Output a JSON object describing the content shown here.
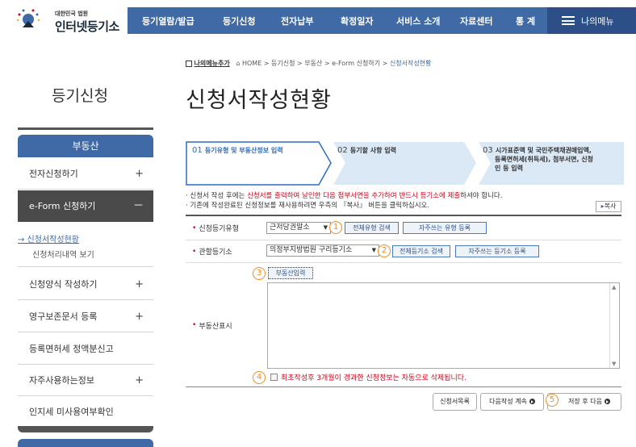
{
  "header": {
    "logo_sub": "대한민국 법원",
    "logo_main": "인터넷등기소",
    "gnb": [
      "등기열람/발급",
      "등기신청",
      "전자납부",
      "확정일자",
      "서비스 소개",
      "자료센터",
      "통 계"
    ],
    "my_menu": "나의메뉴"
  },
  "sidebar": {
    "title": "등기신청",
    "section": "부동산",
    "items": [
      {
        "label": "전자신청하기",
        "toggle": "+"
      },
      {
        "label": "e-Form 신청하기",
        "toggle": "－"
      },
      {
        "label": "신청양식 작성하기",
        "toggle": "+"
      },
      {
        "label": "영구보존문서 등록",
        "toggle": "+"
      },
      {
        "label": "등록면허세 정액분신고",
        "toggle": ""
      },
      {
        "label": "자주사용하는정보",
        "toggle": "+"
      },
      {
        "label": "인지세 미사용여부확인",
        "toggle": ""
      }
    ],
    "sub_items": [
      "→ 신청서작성현황",
      "신청처리내역 보기"
    ]
  },
  "breadcrumb": {
    "favorite": "나의메뉴추가",
    "path": "HOME > 등기신청 > 부동산 > e-Form 신청하기 > ",
    "current": "신청서작성현황"
  },
  "page_title": "신청서작성현황",
  "steps": [
    {
      "num": "01",
      "text": "등기유형 및 부동산정보 입력"
    },
    {
      "num": "02",
      "text": "등기할 사항 입력"
    },
    {
      "num": "03",
      "text_lines": [
        "시가표준액 및 국민주택채권매입액,",
        "등록면허세(취득세), 첨부서면, 신청",
        "인 등 입력"
      ]
    }
  ],
  "notes": {
    "line1_a": "· 신청서 작성 후에는 ",
    "line1_red": "신청서를 출력하여 날인한 다음 첨부서면을 추가하여 반드시 등기소에 제출",
    "line1_b": "하셔야 합니다.",
    "line2": "· 기존에 작성완료된 신청정보를 재사용하려면 우측의 『복사』 버튼을 클릭하십시오.",
    "copy_btn": "복사"
  },
  "form": {
    "type_label": "신청등기유형",
    "type_value": "근저당권말소",
    "type_search": "전체유형 검색",
    "type_fav": "자주쓰는 유형 등록",
    "office_label": "관할등기소",
    "office_value": "의정부지방법원  구리등기소",
    "office_search": "전체등기소 검색",
    "office_fav": "자주쓰는 등기소 등록",
    "property_label": "부동산표시",
    "property_btn": "부동산입력",
    "auto_delete": "최초작성후 3개월이 경과한 신청정보는 자동으로 삭제됩니다."
  },
  "markers": [
    "1",
    "2",
    "3",
    "4",
    "5"
  ],
  "buttons": {
    "list": "신청서목록",
    "later": "다음작성 계속",
    "save_next": "저장 후 다음"
  }
}
